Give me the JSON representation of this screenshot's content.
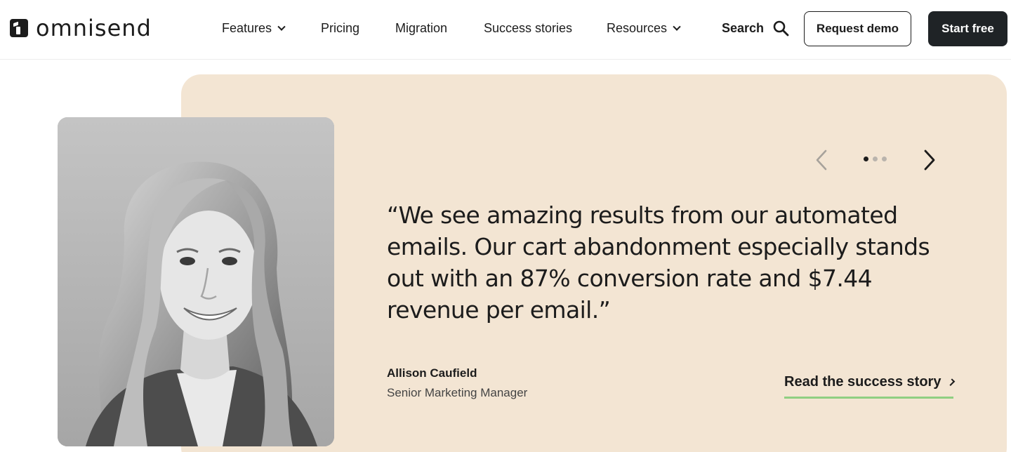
{
  "brand": {
    "name": "omnisend"
  },
  "nav": {
    "items": [
      {
        "label": "Features",
        "dropdown": true
      },
      {
        "label": "Pricing",
        "dropdown": false
      },
      {
        "label": "Migration",
        "dropdown": false
      },
      {
        "label": "Success stories",
        "dropdown": false
      },
      {
        "label": "Resources",
        "dropdown": true
      }
    ],
    "search_label": "Search",
    "search_icon": "search-icon",
    "request_demo_label": "Request demo",
    "start_free_label": "Start free"
  },
  "testimonial": {
    "quote": "“We see amazing results from our automated emails. Our cart abandonment especially stands out with an 87% conversion rate and $7.44 revenue per email.”",
    "author_name": "Allison Caufield",
    "author_role": "Senior Marketing Manager",
    "cta_label": "Read the success story",
    "slides_total": 3,
    "slide_active": 1
  },
  "colors": {
    "card_bg": "#f3e5d3",
    "primary_dark": "#1f2326",
    "cta_underline": "#8fcf82"
  }
}
